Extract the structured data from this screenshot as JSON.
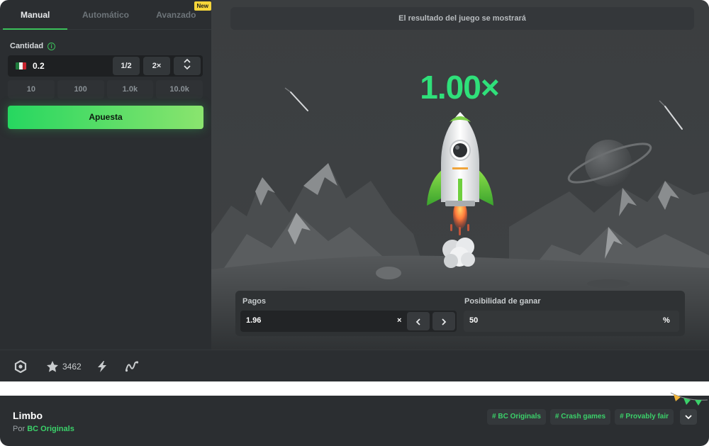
{
  "tabs": [
    {
      "label": "Manual",
      "active": true
    },
    {
      "label": "Automático",
      "active": false
    },
    {
      "label": "Avanzado",
      "active": false,
      "badge": "New"
    }
  ],
  "bet": {
    "amount_label": "Cantidad",
    "amount_value": "0.2",
    "currency_flag": "mexico-flag-icon",
    "half_label": "1/2",
    "double_label": "2×",
    "quick_amounts": [
      "10",
      "100",
      "1.0k",
      "10.0k"
    ],
    "bet_button": "Apuesta"
  },
  "game": {
    "result_message": "El resultado del juego se mostrará",
    "multiplier": "1.00×",
    "payout_label": "Pagos",
    "payout_value": "1.96",
    "payout_suffix": "×",
    "chance_label": "Posibilidad de ganar",
    "chance_value": "50",
    "chance_suffix": "%"
  },
  "toolbar": {
    "favorites_count": "3462",
    "icons": [
      "settings-icon",
      "star-icon",
      "lightning-icon",
      "chart-icon"
    ]
  },
  "footer": {
    "title": "Limbo",
    "by_prefix": "Por",
    "provider": "BC Originals",
    "tags": [
      "# BC Originals",
      "# Crash games",
      "# Provably fair"
    ]
  },
  "colors": {
    "accent_green": "#2fe07a",
    "panel_bg": "#2b2e31",
    "game_bg": "#3a3d3f"
  }
}
